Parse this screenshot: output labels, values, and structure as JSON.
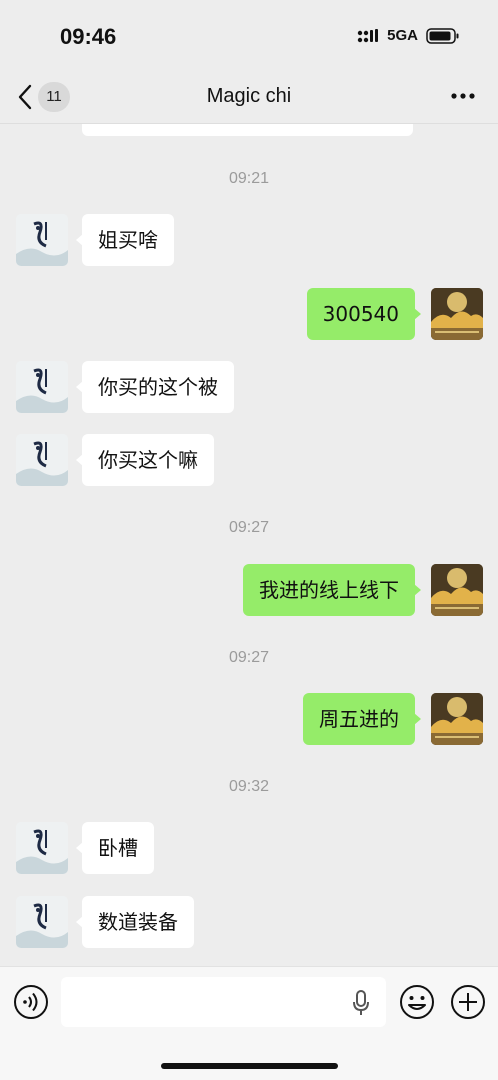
{
  "status": {
    "time": "09:46",
    "network": "5GA"
  },
  "nav": {
    "back_count": "11",
    "title": "Magic chi"
  },
  "messages": [
    {
      "type": "time",
      "text": "09:21"
    },
    {
      "type": "in",
      "text": "姐买啥"
    },
    {
      "type": "out",
      "text": "300540"
    },
    {
      "type": "in",
      "text": "你买的这个被"
    },
    {
      "type": "in",
      "text": "你买这个嘛"
    },
    {
      "type": "time",
      "text": "09:27"
    },
    {
      "type": "out",
      "text": "我进的线上线下"
    },
    {
      "type": "time",
      "text": "09:27"
    },
    {
      "type": "out",
      "text": "周五进的"
    },
    {
      "type": "time",
      "text": "09:32"
    },
    {
      "type": "in",
      "text": "卧槽"
    },
    {
      "type": "in",
      "text": "数道装备"
    }
  ],
  "icons": {
    "back": "chevron-left-icon",
    "more": "more-dots-icon",
    "voice": "voice-icon",
    "mic": "mic-icon",
    "emoji": "emoji-icon",
    "plus": "plus-icon"
  },
  "colors": {
    "background": "#ededed",
    "incoming_bubble": "#ffffff",
    "outgoing_bubble": "#95ec69",
    "timestamp": "#9b9b9b"
  }
}
